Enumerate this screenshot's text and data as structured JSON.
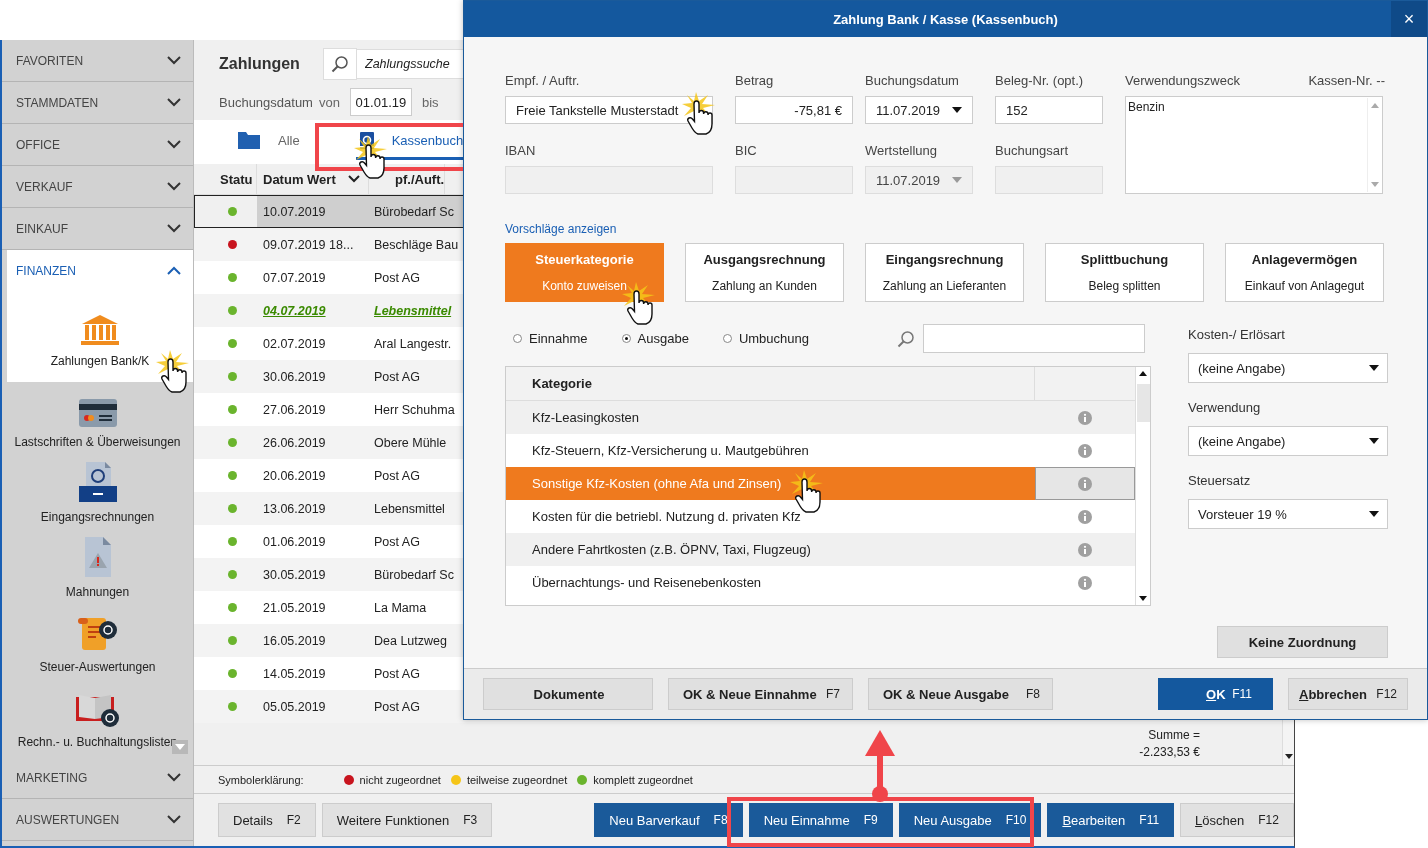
{
  "sidebar": {
    "sections": [
      {
        "label": "FAVORITEN",
        "expanded": false
      },
      {
        "label": "STAMMDATEN",
        "expanded": false
      },
      {
        "label": "OFFICE",
        "expanded": false
      },
      {
        "label": "VERKAUF",
        "expanded": false
      },
      {
        "label": "EINKAUF",
        "expanded": false
      },
      {
        "label": "FINANZEN",
        "expanded": true,
        "items": [
          {
            "label": "Zahlungen Bank/K",
            "kind": "bank",
            "selected": true
          },
          {
            "label": "Lastschriften & Überweisungen",
            "kind": "card",
            "selected": false
          },
          {
            "label": "Eingangsrechnungen",
            "kind": "inbox",
            "selected": false
          },
          {
            "label": "Mahnungen",
            "kind": "warning",
            "selected": false
          },
          {
            "label": "Steuer-Auswertungen",
            "kind": "scroll",
            "selected": false
          },
          {
            "label": "Rechn.- u. Buchhaltungslisten",
            "kind": "book",
            "selected": false
          }
        ]
      },
      {
        "label": "MARKETING",
        "expanded": false
      },
      {
        "label": "AUSWERTUNGEN",
        "expanded": false
      }
    ]
  },
  "payments": {
    "title": "Zahlungen",
    "search": {
      "placeholder": "Zahlungssuche"
    },
    "date_filter": {
      "label": "Buchungsdatum",
      "from_label": "von",
      "from": "01.01.19",
      "to_label": "bis"
    },
    "tabs": [
      {
        "label": "Alle",
        "kind": "folder",
        "selected": false
      },
      {
        "label": "Kassenbuch",
        "kind": "cashbook",
        "selected": true
      }
    ],
    "columns": [
      {
        "label": "Statu",
        "sorted": false
      },
      {
        "label": "Datum Wert",
        "sorted": true
      },
      {
        "label": "pf./Auft.",
        "sorted": false
      }
    ],
    "rows": [
      {
        "color": "#6ab42d",
        "date": "10.07.2019",
        "name": "Bürobedarf Sc",
        "selected": true,
        "emphasized": false
      },
      {
        "color": "#c8141e",
        "date": "09.07.2019 18...",
        "name": "Beschläge Bau",
        "selected": false,
        "emphasized": false
      },
      {
        "color": "#6ab42d",
        "date": "07.07.2019",
        "name": "Post AG",
        "selected": false,
        "emphasized": false
      },
      {
        "color": "#6ab42d",
        "date": "04.07.2019",
        "name": "Lebensmittel",
        "selected": false,
        "emphasized": true
      },
      {
        "color": "#6ab42d",
        "date": "02.07.2019",
        "name": "Aral Langestr.",
        "selected": false,
        "emphasized": false
      },
      {
        "color": "#6ab42d",
        "date": "30.06.2019",
        "name": "Post AG",
        "selected": false,
        "emphasized": false
      },
      {
        "color": "#6ab42d",
        "date": "27.06.2019",
        "name": "Herr Schuhma",
        "selected": false,
        "emphasized": false
      },
      {
        "color": "#6ab42d",
        "date": "26.06.2019",
        "name": "Obere Mühle",
        "selected": false,
        "emphasized": false
      },
      {
        "color": "#6ab42d",
        "date": "20.06.2019",
        "name": "Post AG",
        "selected": false,
        "emphasized": false
      },
      {
        "color": "#6ab42d",
        "date": "13.06.2019",
        "name": "Lebensmittel",
        "selected": false,
        "emphasized": false
      },
      {
        "color": "#6ab42d",
        "date": "01.06.2019",
        "name": "Post AG",
        "selected": false,
        "emphasized": false
      },
      {
        "color": "#6ab42d",
        "date": "30.05.2019",
        "name": "Bürobedarf Sc",
        "selected": false,
        "emphasized": false
      },
      {
        "color": "#6ab42d",
        "date": "21.05.2019",
        "name": "La Mama",
        "selected": false,
        "emphasized": false
      },
      {
        "color": "#6ab42d",
        "date": "16.05.2019",
        "name": "Dea Lutzweg",
        "selected": false,
        "emphasized": false
      },
      {
        "color": "#6ab42d",
        "date": "14.05.2019",
        "name": "Post AG",
        "selected": false,
        "emphasized": false
      },
      {
        "color": "#6ab42d",
        "date": "05.05.2019",
        "name": "Post AG",
        "selected": false,
        "emphasized": false
      }
    ],
    "sum_label": "Summe =",
    "sum": "-2.233,53 €",
    "legend": {
      "label": "Symbolerklärung:",
      "items": [
        {
          "label": "nicht zugeordnet",
          "color": "#c8141e"
        },
        {
          "label": "teilweise zugeordnet",
          "color": "#f5c518"
        },
        {
          "label": "komplett zugeordnet",
          "color": "#6ab42d"
        }
      ]
    },
    "buttons": [
      {
        "label": "Details",
        "key": "F2",
        "kind": "plain",
        "mnemonic": false
      },
      {
        "label": "Weitere Funktionen",
        "key": "F3",
        "kind": "plain",
        "mnemonic": false
      },
      {
        "label": "Neu Barverkauf",
        "key": "F8",
        "kind": "primary",
        "mnemonic": false
      },
      {
        "label": "Neu Einnahme",
        "key": "F9",
        "kind": "primary",
        "mnemonic": false
      },
      {
        "label": "Neu Ausgabe",
        "key": "F10",
        "kind": "primary",
        "mnemonic": false
      },
      {
        "label": "Bearbeiten",
        "key": "F11",
        "kind": "primary",
        "mnemonic": true
      },
      {
        "label": "Löschen",
        "key": "F12",
        "kind": "plain",
        "mnemonic": true
      }
    ]
  },
  "dialog": {
    "title": "Zahlung Bank / Kasse (Kassenbuch)",
    "close": "×",
    "fields": [
      {
        "label": "Empf. / Auftr.",
        "value": "Freie Tankstelle Musterstadt",
        "kind": "text",
        "disabled": false
      },
      {
        "label": "Betrag",
        "value": "-75,81 €",
        "kind": "amount",
        "disabled": false
      },
      {
        "label": "Buchungsdatum",
        "value": "11.07.2019",
        "kind": "dropdown",
        "disabled": false
      },
      {
        "label": "Beleg-Nr. (opt.)",
        "value": "152",
        "kind": "text",
        "disabled": false
      },
      {
        "label": "IBAN",
        "kind": "text",
        "disabled": true
      },
      {
        "label": "BIC",
        "kind": "text",
        "disabled": true
      },
      {
        "label": "Wertstellung",
        "value": "11.07.2019",
        "kind": "dropdown",
        "disabled": true
      },
      {
        "label": "Buchungsart",
        "kind": "text",
        "disabled": true
      }
    ],
    "purpose": {
      "label": "Verwendungszweck",
      "value": "Benzin"
    },
    "cash_no": "Kassen-Nr. --",
    "suggestions_link": "Vorschläge anzeigen",
    "cards": [
      {
        "title": "Steuerkategorie",
        "subtitle": "Konto zuweisen",
        "selected": true
      },
      {
        "title": "Ausgangsrechnung",
        "subtitle": "Zahlung an Kunden",
        "selected": false
      },
      {
        "title": "Eingangsrechnung",
        "subtitle": "Zahlung an Lieferanten",
        "selected": false
      },
      {
        "title": "Splittbuchung",
        "subtitle": "Beleg splitten",
        "selected": false
      },
      {
        "title": "Anlagevermögen",
        "subtitle": "Einkauf von Anlagegut",
        "selected": false
      }
    ],
    "type_options": [
      {
        "label": "Einnahme",
        "selected": false
      },
      {
        "label": "Ausgabe",
        "selected": true
      },
      {
        "label": "Umbuchung",
        "selected": false
      }
    ],
    "categories": {
      "header": "Kategorie",
      "rows": [
        {
          "label": "Kfz-Leasingkosten",
          "selected": false
        },
        {
          "label": "Kfz-Steuern, Kfz-Versicherung u. Mautgebühren",
          "selected": false
        },
        {
          "label": "Sonstige Kfz-Kosten (ohne Afa und Zinsen)",
          "selected": true
        },
        {
          "label": "Kosten für die betriebl. Nutzung d. privaten Kfz",
          "selected": false
        },
        {
          "label": "Andere Fahrtkosten (z.B. ÖPNV, Taxi, Flugzeug)",
          "selected": false
        },
        {
          "label": "Übernachtungs- und Reisenebenkosten",
          "selected": false
        }
      ]
    },
    "selects": [
      {
        "label": "Kosten-/ Erlösart",
        "value": "(keine Angabe)"
      },
      {
        "label": "Verwendung",
        "value": "(keine Angabe)"
      },
      {
        "label": "Steuersatz",
        "value": "Vorsteuer 19 %"
      }
    ],
    "no_assignment": "Keine Zuordnung",
    "footer_buttons": [
      {
        "label": "Dokumente",
        "kind": "plain",
        "mnemonic": false
      },
      {
        "label": "OK & Neue Einnahme",
        "key": "F7",
        "kind": "plain",
        "mnemonic": false
      },
      {
        "label": "OK & Neue Ausgabe",
        "key": "F8",
        "kind": "plain",
        "mnemonic": false
      },
      {
        "label": "OK",
        "key": "F11",
        "kind": "primary",
        "mnemonic": true
      },
      {
        "label": "Abbrechen",
        "key": "F12",
        "kind": "plain",
        "mnemonic": true
      }
    ]
  }
}
